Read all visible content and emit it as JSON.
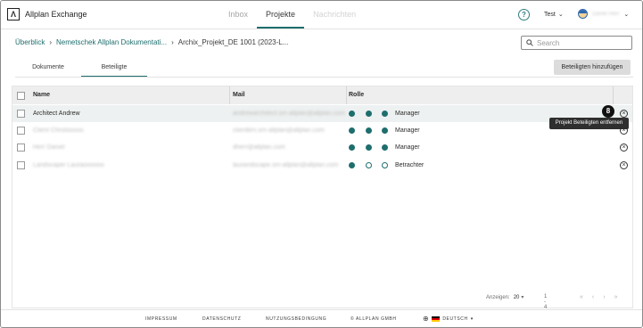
{
  "app": {
    "name": "Allplan Exchange",
    "logo_letter": "Λ"
  },
  "nav": [
    {
      "label": "Inbox",
      "state": "normal"
    },
    {
      "label": "Projekte",
      "state": "active"
    },
    {
      "label": "Nachrichten",
      "state": "disabled"
    }
  ],
  "header": {
    "help": "?",
    "context": "Test",
    "user_name": "Daniel Herr"
  },
  "breadcrumb": [
    "Überblick",
    "Nemetschek Allplan Dokumentati...",
    "Archix_Projekt_DE 1001 (2023-L..."
  ],
  "search": {
    "placeholder": "Search"
  },
  "tabs": [
    {
      "label": "Dokumente",
      "active": false
    },
    {
      "label": "Beteiligte",
      "active": true
    }
  ],
  "add_button": "Beteiligten hinzufügen",
  "table": {
    "headers": {
      "name": "Name",
      "mail": "Mail",
      "role": "Rolle"
    },
    "rows": [
      {
        "name": "Architect Andrew",
        "name_blur": false,
        "mail": "andrewarchitect.sm-allplan@allplan.com",
        "perms": [
          true,
          true,
          true
        ],
        "role": "Manager"
      },
      {
        "name": "Client Christoosos",
        "name_blur": true,
        "mail": "clientbrn.sm-allplan@allplan.com",
        "perms": [
          true,
          true,
          true
        ],
        "role": "Manager"
      },
      {
        "name": "Herr Daniel",
        "name_blur": true,
        "mail": "dherr@allplan.com",
        "perms": [
          true,
          true,
          true
        ],
        "role": "Manager"
      },
      {
        "name": "Landscaper Lauraoooooo",
        "name_blur": true,
        "mail": "laurandscape.sm-allplan@allplan.com",
        "perms": [
          true,
          false,
          false
        ],
        "role": "Betrachter"
      }
    ]
  },
  "tooltip": "Projekt Beteiligten entfernen",
  "step_badge": "8",
  "pagination": {
    "label": "Anzeigen:",
    "size": "20",
    "range": "1 - 4 / 4",
    "nav": [
      "«",
      "‹",
      "›",
      "»"
    ]
  },
  "footer": {
    "links": [
      "IMPRESSUM",
      "DATENSCHUTZ",
      "NUTZUNGSBEDINGUNG",
      "© ALLPLAN GMBH"
    ],
    "language": "DEUTSCH"
  },
  "colors": {
    "accent": "#1f6e6e",
    "flag": [
      "#000000",
      "#dd0000",
      "#ffce00"
    ]
  },
  "icons": [
    "help-icon",
    "search-icon",
    "globe-icon",
    "remove-circle-icon"
  ]
}
